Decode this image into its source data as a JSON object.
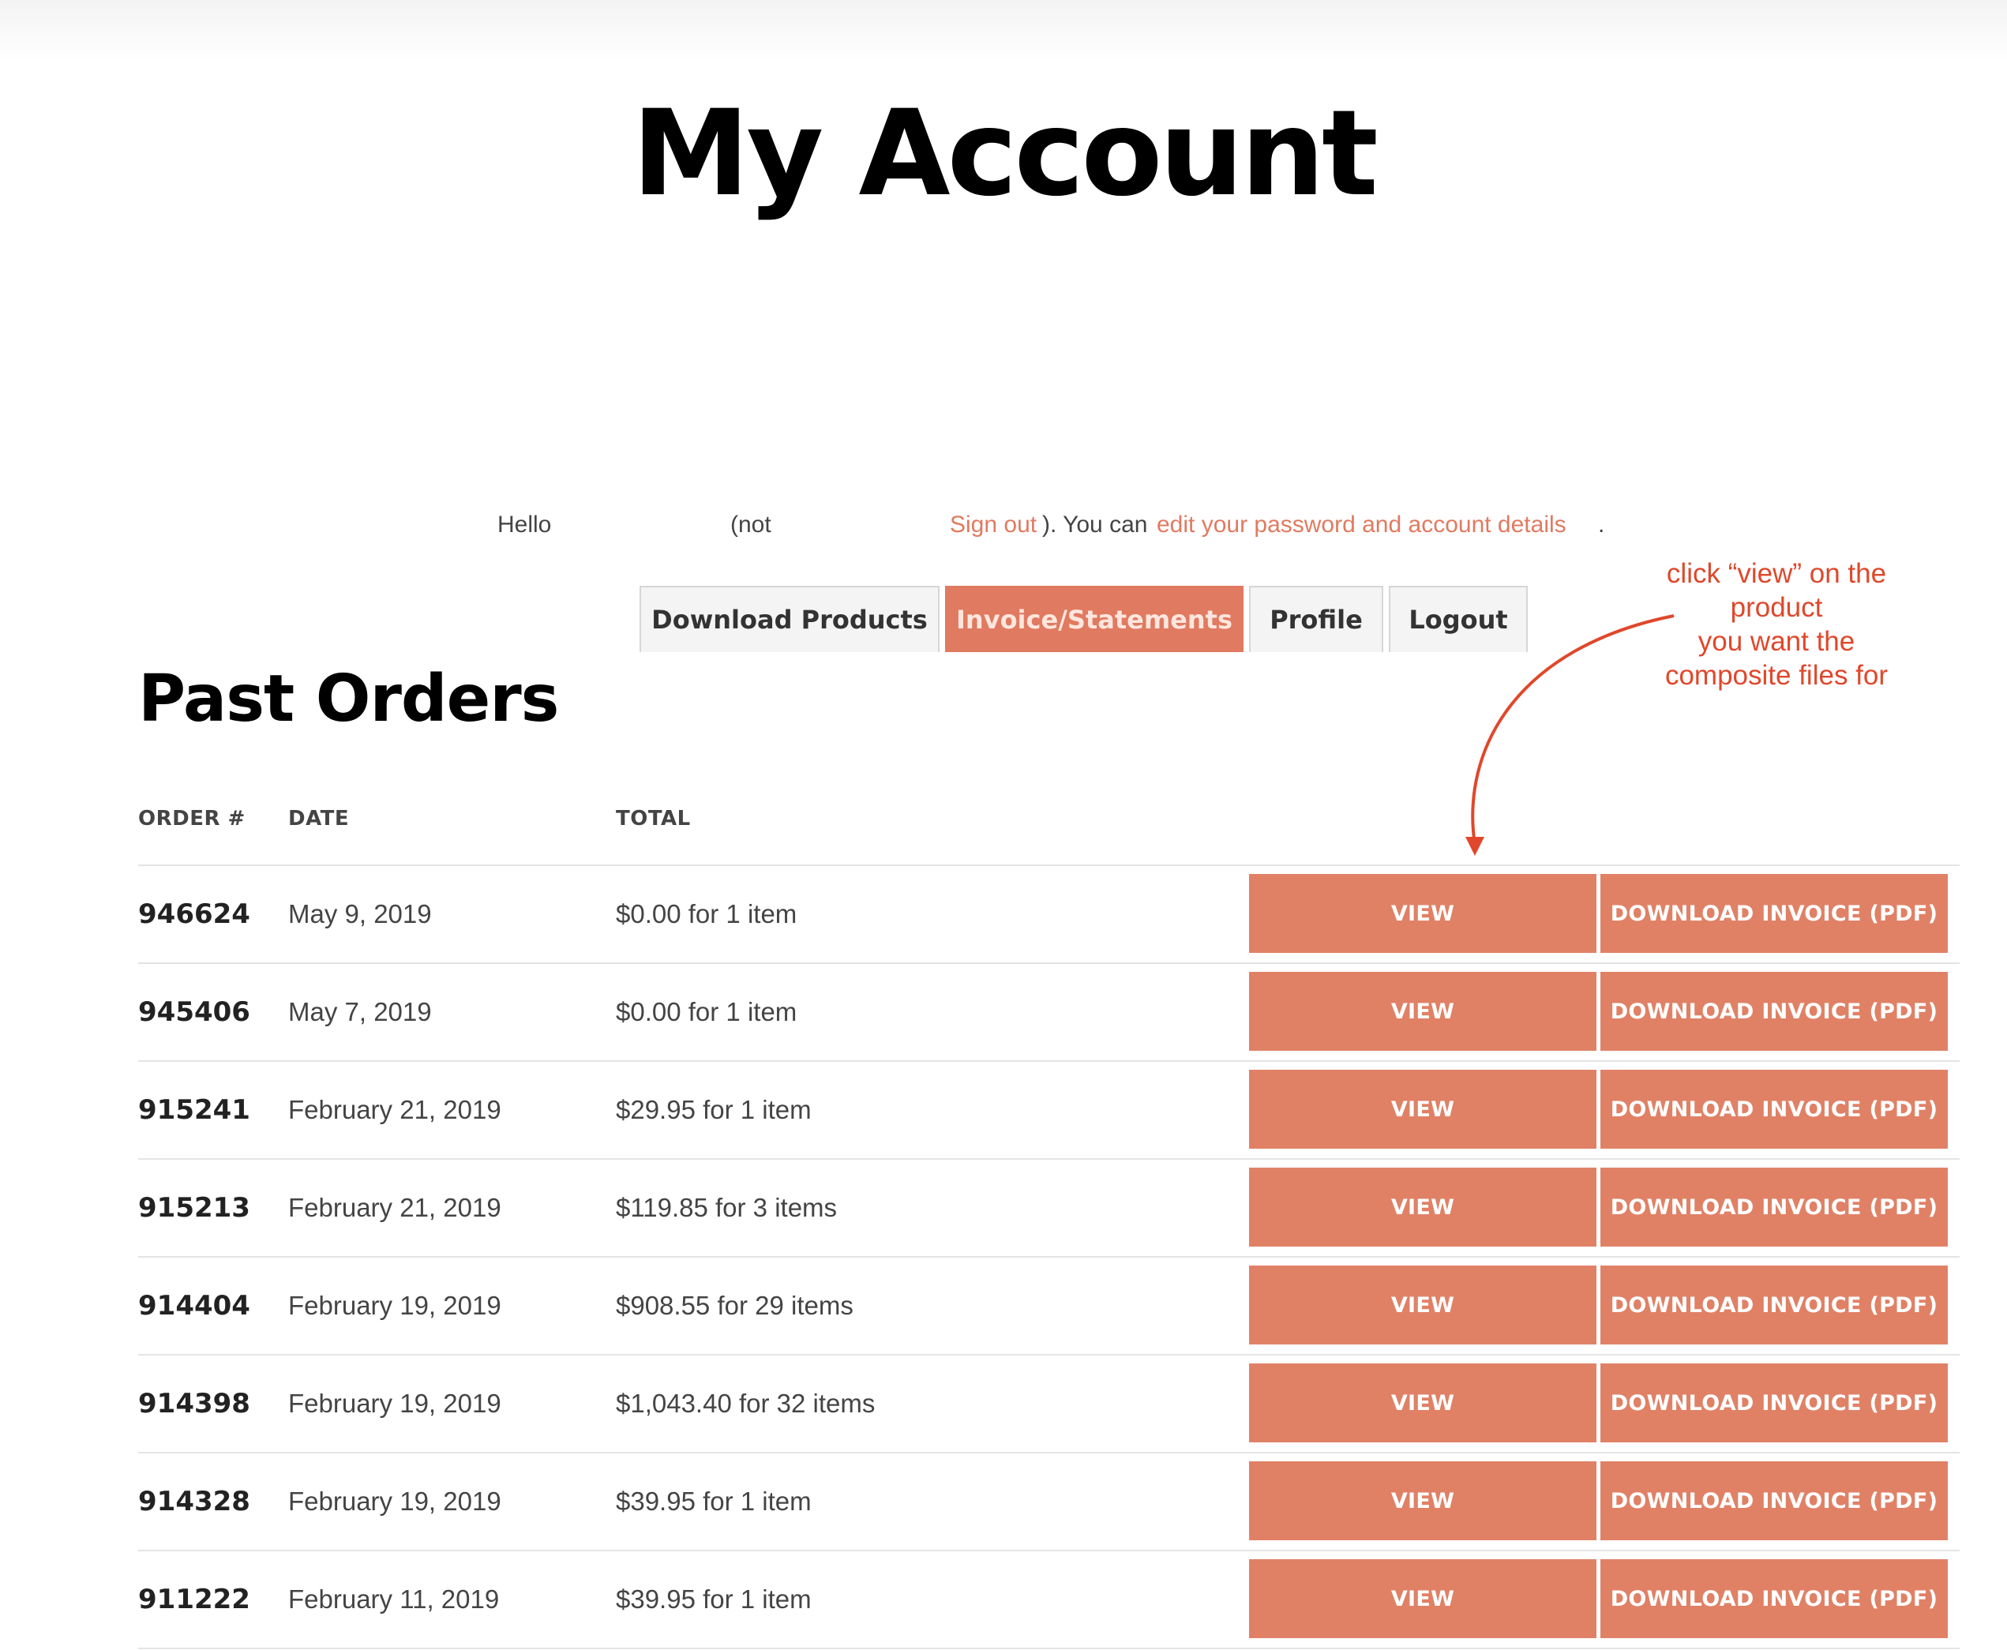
{
  "page": {
    "title": "My Account"
  },
  "greeting": {
    "hello": "Hello",
    "not": "(not",
    "sign_out": "Sign out",
    "middle": "). You can ",
    "edit_link": "edit your password and account details",
    "end": "."
  },
  "tabs": [
    {
      "label": "Download Products",
      "active": false
    },
    {
      "label": "Invoice/Statements",
      "active": true
    },
    {
      "label": "Profile",
      "active": false
    },
    {
      "label": "Logout",
      "active": false
    }
  ],
  "section": {
    "title": "Past Orders"
  },
  "annotation": {
    "lines": [
      "click “view” on the",
      "product",
      "you want the",
      "composite files for"
    ],
    "color": "#e0472b"
  },
  "table": {
    "headers": {
      "order": "ORDER #",
      "date": "DATE",
      "total": "TOTAL"
    },
    "view_label": "VIEW",
    "pdf_label": "DOWNLOAD INVOICE (PDF)",
    "rows": [
      {
        "order": "946624",
        "date": "May 9, 2019",
        "total": "$0.00 for 1 item"
      },
      {
        "order": "945406",
        "date": "May 7, 2019",
        "total": "$0.00 for 1 item"
      },
      {
        "order": "915241",
        "date": "February 21, 2019",
        "total": "$29.95 for 1 item"
      },
      {
        "order": "915213",
        "date": "February 21, 2019",
        "total": "$119.85 for 3 items"
      },
      {
        "order": "914404",
        "date": "February 19, 2019",
        "total": "$908.55 for 29 items"
      },
      {
        "order": "914398",
        "date": "February 19, 2019",
        "total": "$1,043.40 for 32 items"
      },
      {
        "order": "914328",
        "date": "February 19, 2019",
        "total": "$39.95 for 1 item"
      },
      {
        "order": "911222",
        "date": "February 11, 2019",
        "total": "$39.95 for 1 item"
      }
    ]
  },
  "colors": {
    "accent": "#e07a60",
    "button": "#e08166",
    "annotation": "#e0472b"
  }
}
